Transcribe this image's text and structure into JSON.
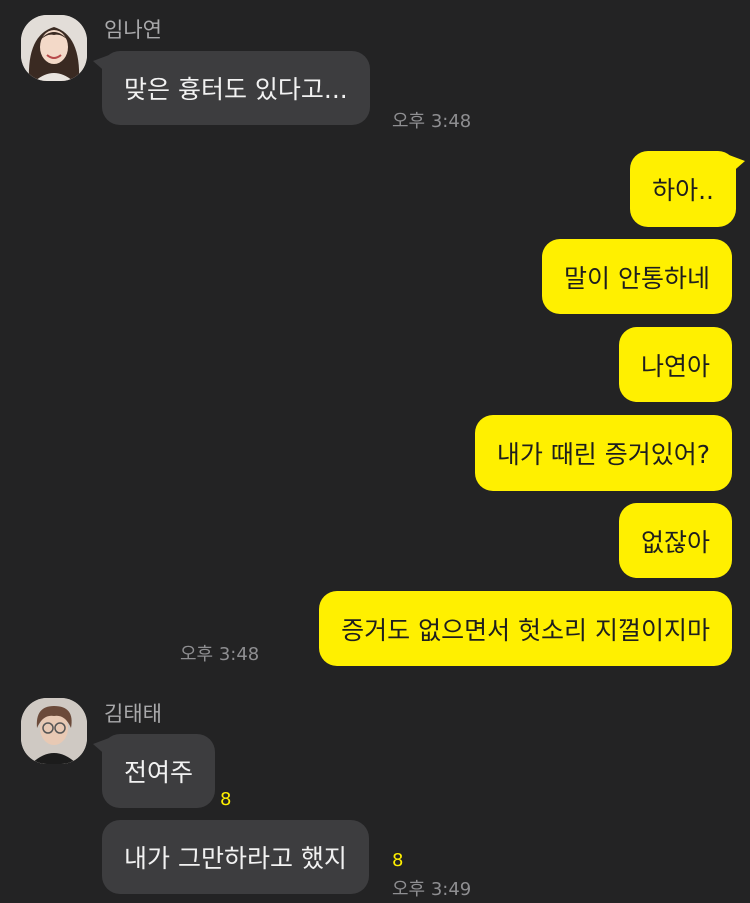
{
  "colors": {
    "background": "#232324",
    "incoming_bubble": "#3d3d3f",
    "outgoing_bubble": "#fff000",
    "unread_count": "#fff000"
  },
  "messages": {
    "nayeon": {
      "sender": "임나연",
      "avatar_icon": "profile-photo",
      "text": "맞은 흉터도 있다고...",
      "time": "오후 3:48"
    },
    "outgoing": [
      {
        "text": "하아.."
      },
      {
        "text": "말이 안통하네"
      },
      {
        "text": "나연아"
      },
      {
        "text": "내가 때린 증거있어?"
      },
      {
        "text": "없잖아"
      },
      {
        "text": "증거도 없으면서 헛소리 지껄이지마"
      }
    ],
    "outgoing_time": "오후 3:48",
    "taetae": {
      "sender": "김태태",
      "avatar_icon": "profile-photo",
      "items": [
        {
          "text": "전여주",
          "unread": "8"
        },
        {
          "text": "내가 그만하라고 했지",
          "unread": "8",
          "time": "오후 3:49"
        }
      ]
    }
  }
}
